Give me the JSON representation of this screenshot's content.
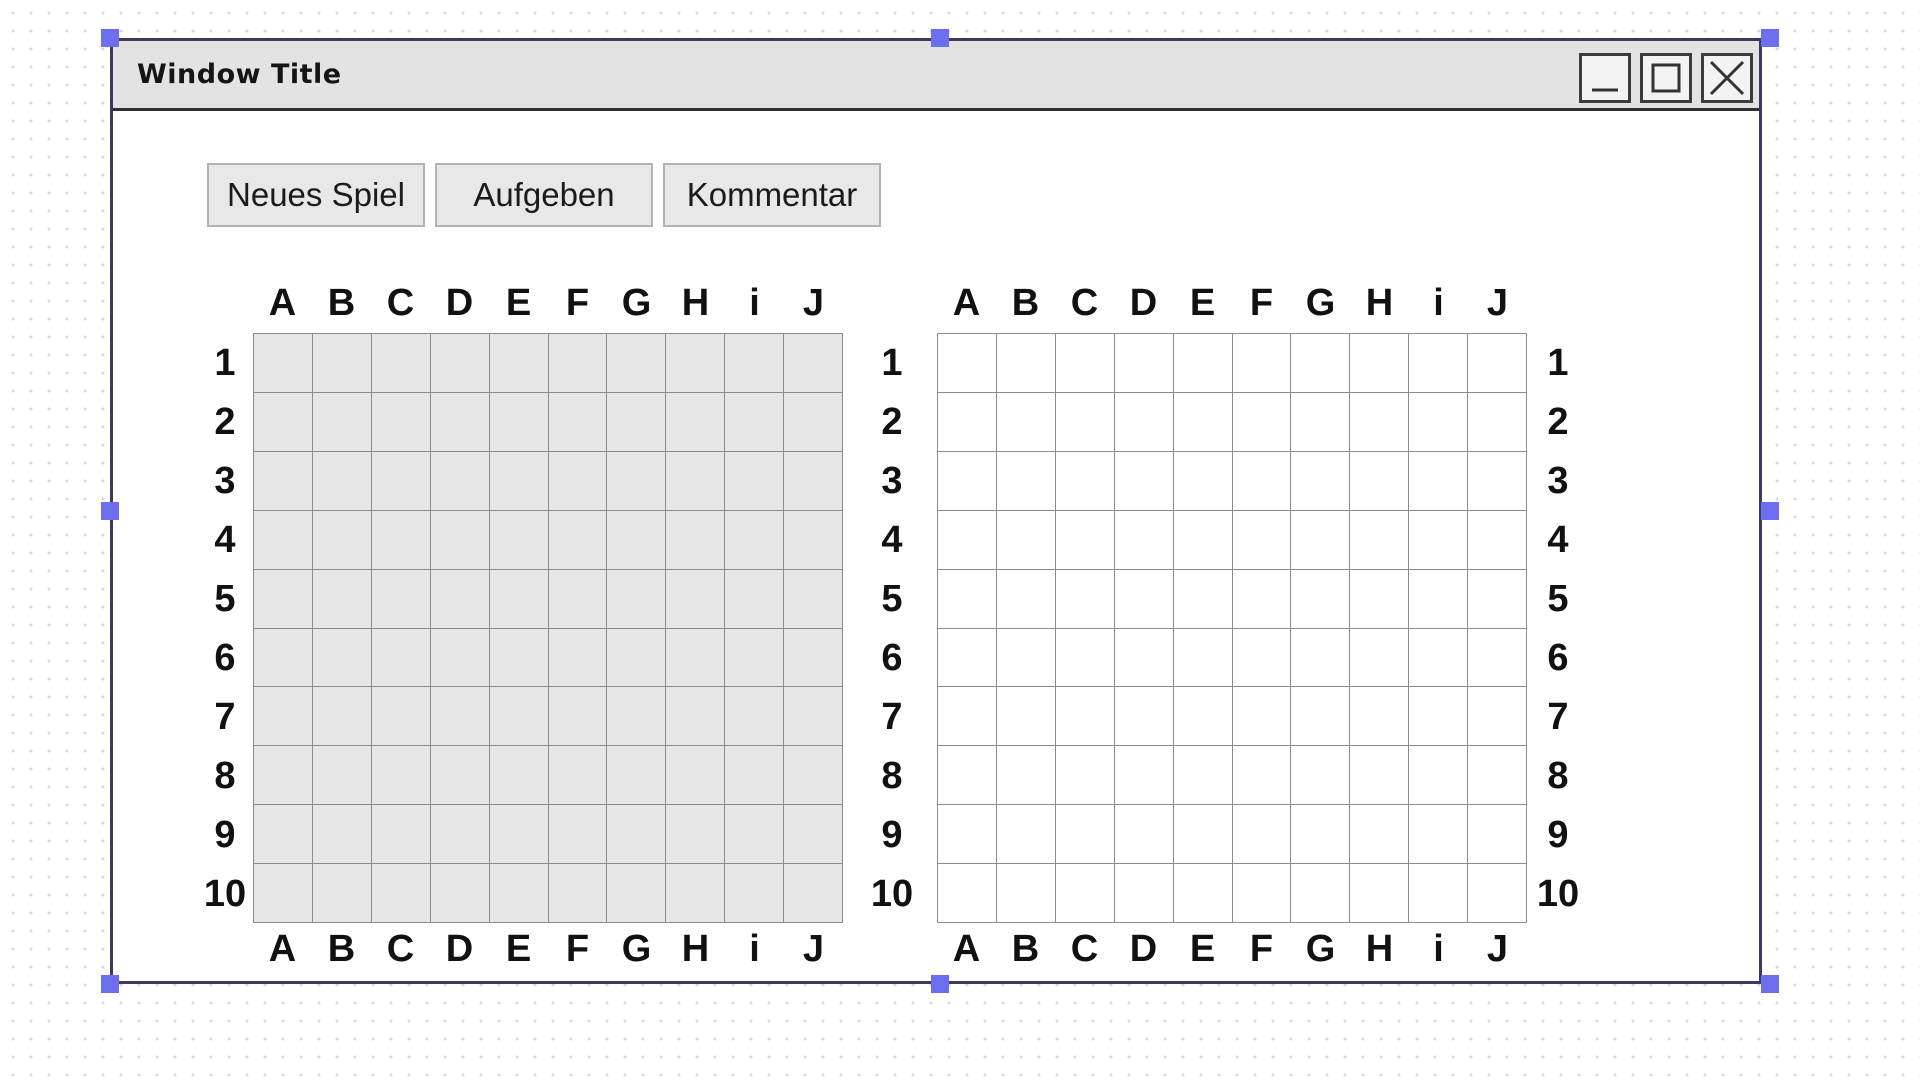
{
  "window": {
    "title": "Window Title",
    "buttons": {
      "minimize": "minimize-icon",
      "maximize": "maximize-icon",
      "close": "close-icon"
    }
  },
  "toolbar": {
    "new_game_label": "Neues Spiel",
    "give_up_label": "Aufgeben",
    "comment_label": "Kommentar"
  },
  "boards": {
    "column_labels": [
      "A",
      "B",
      "C",
      "D",
      "E",
      "F",
      "G",
      "H",
      "i",
      "J"
    ],
    "row_labels": [
      "1",
      "2",
      "3",
      "4",
      "5",
      "6",
      "7",
      "8",
      "9",
      "10"
    ],
    "own_board_color": "#e6e6e6",
    "opponent_board_color": "#ffffff"
  },
  "colors": {
    "selection_handle": "#6d6df0",
    "title_bar": "#e3e3e3"
  }
}
